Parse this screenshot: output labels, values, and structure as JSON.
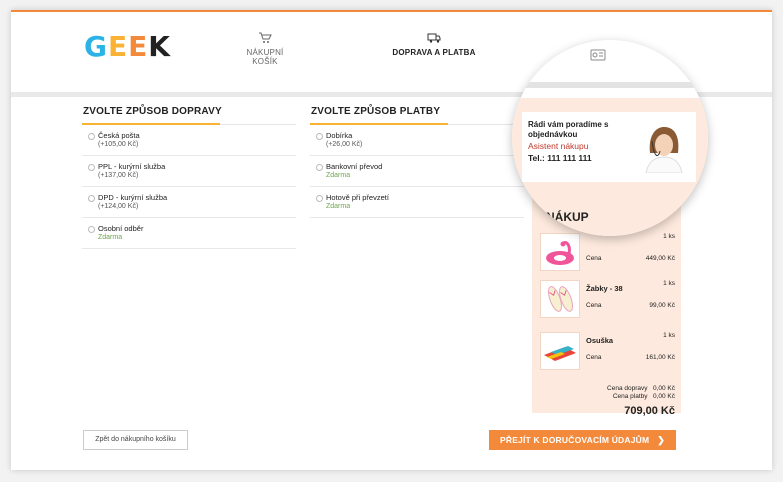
{
  "header": {
    "logo_letters": [
      "G",
      "E",
      "E",
      "K"
    ],
    "steps": [
      {
        "label": "NÁKUPNÍ KOŠÍK",
        "icon": "cart-icon"
      },
      {
        "label": "DOPRAVA A PLATBA",
        "icon": "truck-icon"
      },
      {
        "label": "",
        "icon": "id-card-icon"
      }
    ]
  },
  "shipping": {
    "title": "ZVOLTE ZPŮSOB DOPRAVY",
    "options": [
      {
        "name": "Česká pošta",
        "price": "(+105,00 Kč)"
      },
      {
        "name": "PPL - kurýrní služba",
        "price": "(+137,00 Kč)"
      },
      {
        "name": "DPD - kurýrní služba",
        "price": "(+124,00 Kč)"
      },
      {
        "name": "Osobní odběr",
        "price": "Zdarma"
      }
    ]
  },
  "payment": {
    "title": "ZVOLTE ZPŮSOB PLATBY",
    "options": [
      {
        "name": "Dobírka",
        "price": "(+26,00 Kč)"
      },
      {
        "name": "Bankovní převod",
        "price": "Zdarma"
      },
      {
        "name": "Hotově při převzetí",
        "price": "Zdarma"
      }
    ]
  },
  "assistant": {
    "line1": "Rádi vám poradíme s objednávkou",
    "role": "Asistent nákupu",
    "phone": "Tel.: 111 111 111"
  },
  "summary": {
    "title": "NÁKUP",
    "price_label": "Cena",
    "items": [
      {
        "name": "",
        "qty": "1 ks",
        "price": "449,00 Kč",
        "icon": "flamingo-float-icon"
      },
      {
        "name": "Žabky - 38",
        "qty": "1 ks",
        "price": "99,00 Kč",
        "icon": "flip-flops-icon"
      },
      {
        "name": "Osuška",
        "qty": "1 ks",
        "price": "161,00 Kč",
        "icon": "towel-icon"
      }
    ],
    "shipping_cost_label": "Cena dopravy",
    "shipping_cost": "0,00 Kč",
    "payment_cost_label": "Cena platby",
    "payment_cost": "0,00 Kč",
    "total": "709,00 Kč"
  },
  "buttons": {
    "back": "Zpět do nákupního košíku",
    "next": "PŘEJÍT K DORUČOVACÍM ÚDAJŮM"
  },
  "colors": {
    "accent": "#f38a3b",
    "summary_bg": "#fde9dd",
    "free_green": "#6ea54b",
    "assistant_red": "#c0392b"
  }
}
